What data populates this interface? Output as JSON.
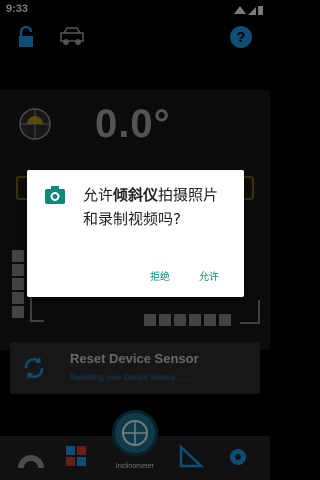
{
  "status_bar": {
    "time": "9:33"
  },
  "main": {
    "angle": "0.0°"
  },
  "reset_card": {
    "title": "Reset Device Sensor",
    "subtitle": "Resetting your Device Sensor........"
  },
  "bottom_nav": {
    "active_label": "Inclinometer"
  },
  "dialog": {
    "message_prefix": "允许",
    "app_name": "倾斜仪",
    "message_suffix": "拍摄照片和录制视频吗?",
    "deny_label": "拒绝",
    "allow_label": "允许"
  },
  "colors": {
    "accent": "#1a8fd6",
    "dialog_button": "#0f8a78",
    "level_bubble": "#b58f1e"
  },
  "icons": [
    "lock-icon",
    "car-icon",
    "help-icon",
    "refresh-icon",
    "camera-icon",
    "settings-icon"
  ]
}
